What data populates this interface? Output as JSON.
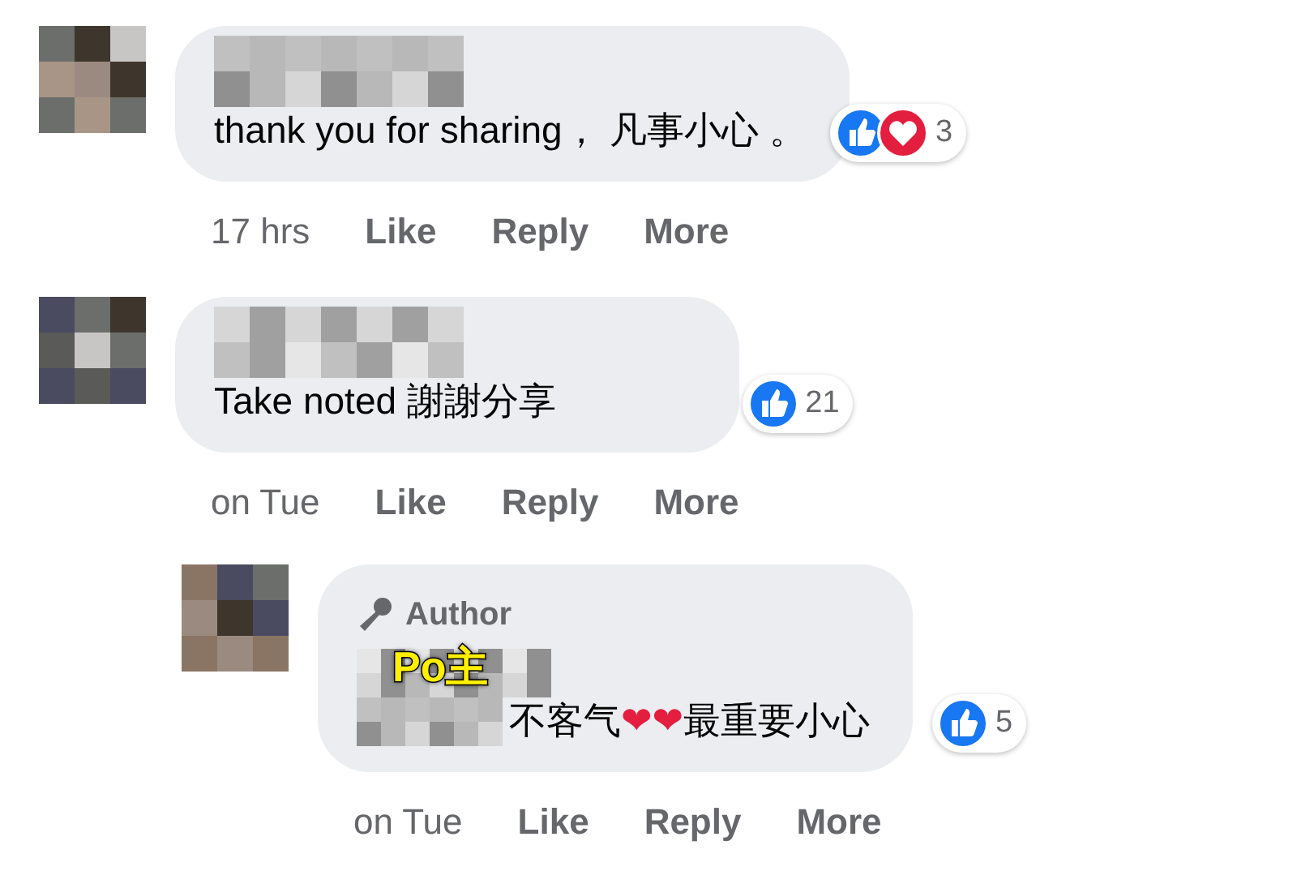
{
  "comments": [
    {
      "reply": false,
      "segments": [
        {
          "kind": "text",
          "text": "thank you for sharing， 凡事小心 。"
        }
      ],
      "reactions": {
        "icons": [
          {
            "kind": "like"
          },
          {
            "kind": "love"
          }
        ],
        "count": "3"
      },
      "time": "17 hrs",
      "actions": [
        "Like",
        "Reply",
        "More"
      ]
    },
    {
      "reply": false,
      "segments": [
        {
          "kind": "text",
          "text": "Take noted 謝謝分享"
        }
      ],
      "reactions": {
        "icons": [
          {
            "kind": "like"
          }
        ],
        "count": "21"
      },
      "time": "on Tue",
      "actions": [
        "Like",
        "Reply",
        "More"
      ]
    },
    {
      "reply": true,
      "author_badge": "Author",
      "sticker": "Po主",
      "segments": [
        {
          "kind": "redacted"
        },
        {
          "kind": "text",
          "text": "不客气"
        },
        {
          "kind": "emoji",
          "text": "❤"
        },
        {
          "kind": "emoji",
          "text": "❤"
        },
        {
          "kind": "text",
          "text": "最重要小心"
        }
      ],
      "reactions": {
        "icons": [
          {
            "kind": "like"
          }
        ],
        "count": "5"
      },
      "time": "on Tue",
      "actions": [
        "Like",
        "Reply",
        "More"
      ]
    }
  ]
}
